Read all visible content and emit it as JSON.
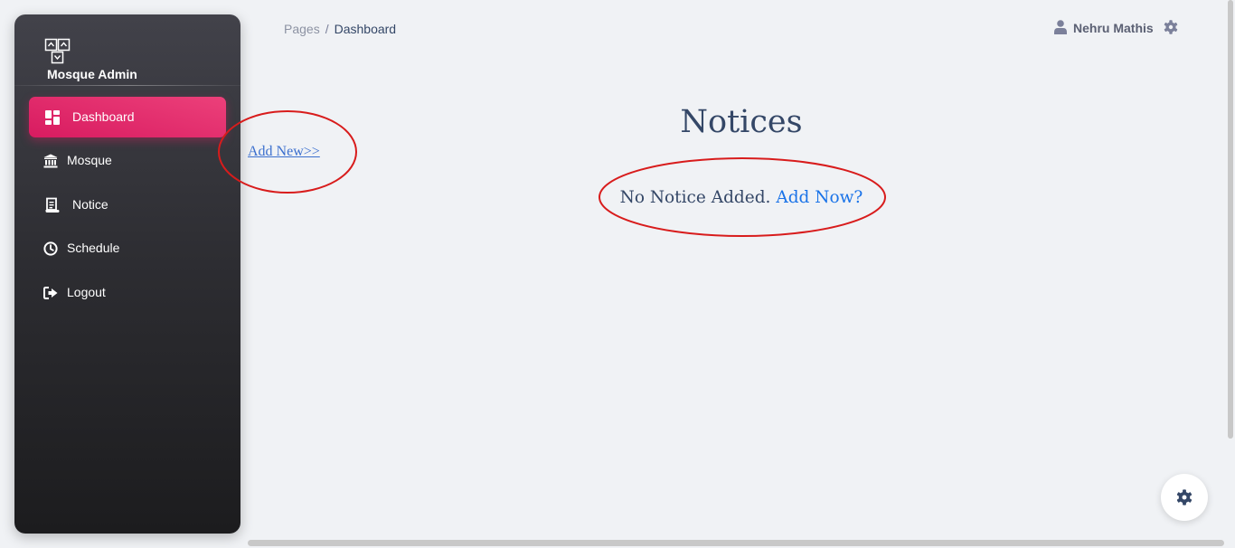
{
  "sidebar": {
    "brand": "Mosque Admin",
    "items": [
      {
        "label": "Dashboard",
        "icon": "dashboard-icon",
        "active": true
      },
      {
        "label": "Mosque",
        "icon": "bank-icon"
      },
      {
        "label": "Notice",
        "icon": "receipt-icon"
      },
      {
        "label": "Schedule",
        "icon": "clock-icon"
      },
      {
        "label": "Logout",
        "icon": "logout-icon"
      }
    ]
  },
  "breadcrumb": {
    "root": "Pages",
    "separator": "/",
    "current": "Dashboard"
  },
  "user": {
    "name": "Nehru Mathis",
    "icon": "user-icon"
  },
  "main": {
    "add_new_link": "Add New>>",
    "title": "Notices",
    "empty_message": "No Notice Added.",
    "add_now_link": "Add Now?"
  },
  "colors": {
    "accent": "#e91e63",
    "text": "#344767",
    "link": "#1a73e8",
    "annotation": "#d81c1c"
  }
}
